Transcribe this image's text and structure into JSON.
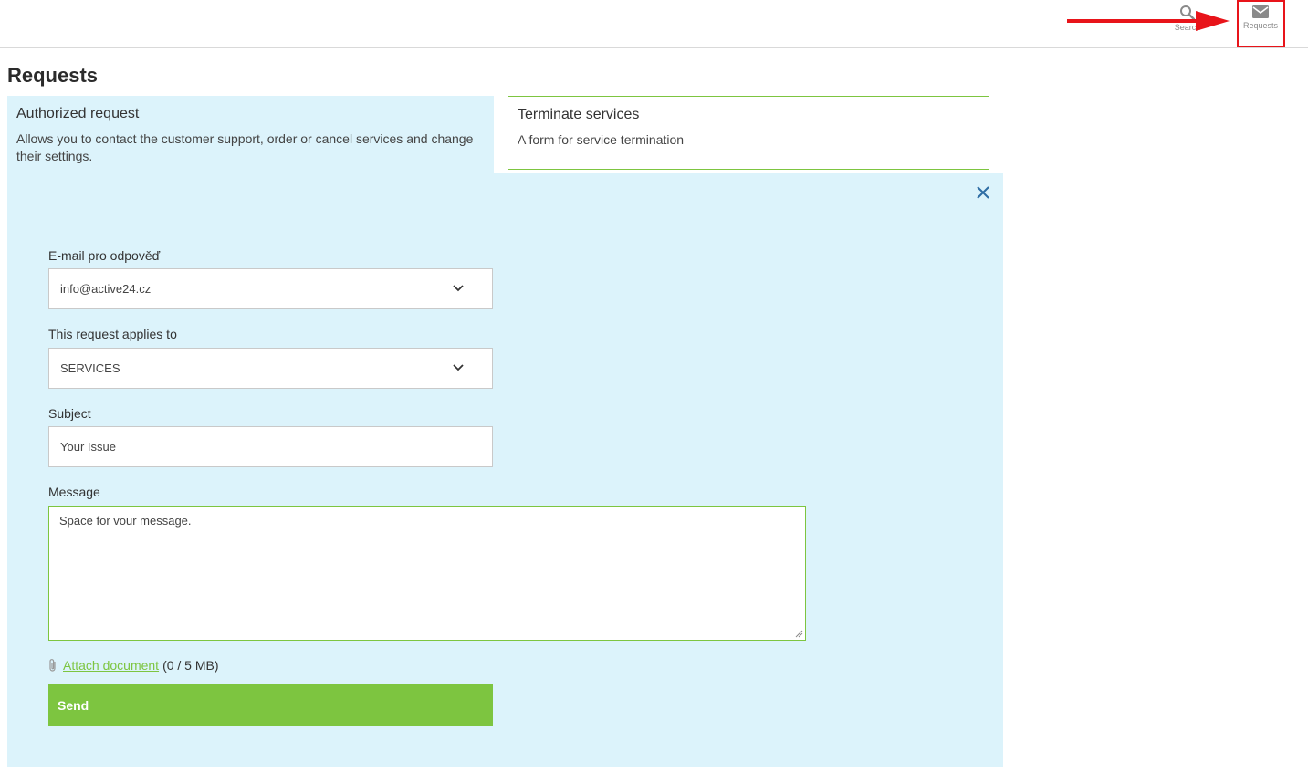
{
  "header": {
    "search_label": "Search",
    "requests_label": "Requests"
  },
  "page": {
    "title": "Requests"
  },
  "cards": {
    "authorized": {
      "title": "Authorized request",
      "description": "Allows you to contact the customer support, order or cancel services and change their settings."
    },
    "terminate": {
      "title": "Terminate services",
      "description": "A form for service termination"
    }
  },
  "form": {
    "email_label": "E-mail pro odpověď",
    "email_value": "info@active24.cz",
    "applies_label": "This request applies to",
    "applies_value": "SERVICES",
    "subject_label": "Subject",
    "subject_value": "Your Issue",
    "message_label": "Message",
    "message_value": "Space for vour message.",
    "attach_link": "Attach document",
    "attach_size": "(0 / 5 MB)",
    "send_label": "Send"
  },
  "colors": {
    "accent": "#7dc540",
    "panel": "#dcf3fb",
    "highlight": "#e8141a"
  }
}
